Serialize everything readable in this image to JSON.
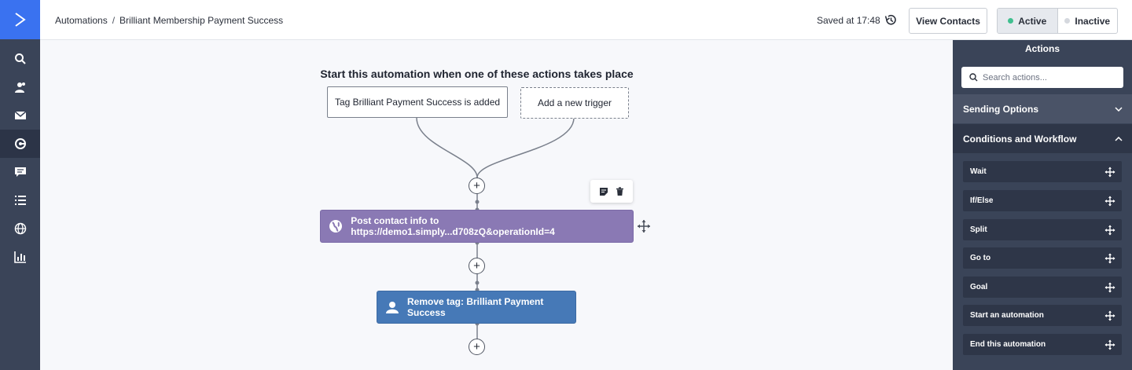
{
  "breadcrumb": {
    "root": "Automations",
    "separator": "/",
    "current": "Brilliant Membership Payment Success"
  },
  "header": {
    "saved_text": "Saved at 17:48",
    "view_contacts_label": "View Contacts",
    "status_toggle": {
      "active_label": "Active",
      "inactive_label": "Inactive",
      "selected": "Active"
    }
  },
  "nav": {
    "items": [
      "search-icon",
      "contacts-icon",
      "mail-icon",
      "automations-icon",
      "conversations-icon",
      "lists-icon",
      "site-icon",
      "reports-icon"
    ],
    "active": "automations-icon"
  },
  "canvas": {
    "heading": "Start this automation when one of these actions takes place",
    "triggers": [
      {
        "label": "Tag Brilliant Payment Success is added"
      },
      {
        "label": "Add a new trigger"
      }
    ],
    "nodes": [
      {
        "label": "Post contact info to https://demo1.simply...d708zQ&operationId=4",
        "icon": "webhook-icon",
        "color": "#8a79b4"
      },
      {
        "label": "Remove tag: Brilliant Payment Success",
        "icon": "contact-icon",
        "color": "#4679b7"
      }
    ],
    "plus_symbol": "+"
  },
  "panel": {
    "title": "Actions",
    "search_placeholder": "Search actions...",
    "sections": [
      {
        "label": "Sending Options",
        "expanded": false
      },
      {
        "label": "Conditions and Workflow",
        "expanded": true
      }
    ],
    "actions": [
      "Wait",
      "If/Else",
      "Split",
      "Go to",
      "Goal",
      "Start an automation",
      "End this automation"
    ]
  },
  "colors": {
    "brand": "#3a72f0",
    "sidebar": "#3a4458",
    "active_dot": "#3fbf8f",
    "inactive_dot": "#d5d8de"
  }
}
